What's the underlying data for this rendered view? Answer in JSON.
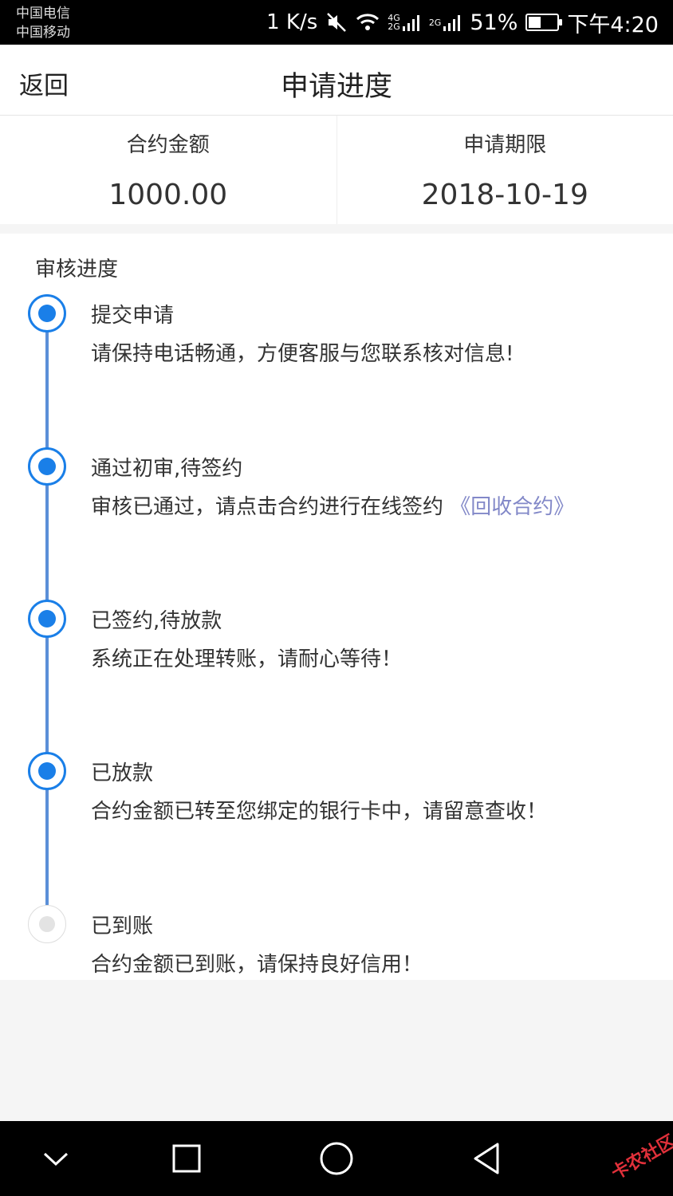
{
  "status_bar": {
    "carrier_1": "中国电信",
    "carrier_2": "中国移动",
    "net_speed": "1 K/s",
    "signal_1_tag_top": "4G",
    "signal_1_tag_bottom": "2G",
    "signal_2_tag": "2G",
    "battery_percent": "51%",
    "battery_level": 0.51,
    "time": "下午4:20",
    "icons": [
      "mute-icon",
      "wifi-icon",
      "signal-icon",
      "signal-icon",
      "battery-icon"
    ]
  },
  "header": {
    "back_label": "返回",
    "title": "申请进度"
  },
  "summary": {
    "amount_label": "合约金额",
    "amount_value": "1000.00",
    "term_label": "申请期限",
    "term_value": "2018-10-19"
  },
  "progress": {
    "title": "审核进度",
    "steps": [
      {
        "title": "提交申请",
        "desc": "请保持电话畅通，方便客服与您联系核对信息!",
        "state": "done"
      },
      {
        "title": "通过初审,待签约",
        "desc": "审核已通过，请点击合约进行在线签约 ",
        "link": "《回收合约》",
        "state": "done"
      },
      {
        "title": "已签约,待放款",
        "desc": "系统正在处理转账，请耐心等待！",
        "state": "done"
      },
      {
        "title": "已放款",
        "desc": "合约金额已转至您绑定的银行卡中，请留意查收！",
        "state": "done"
      },
      {
        "title": "已到账",
        "desc": "合约金额已到账，请保持良好信用！",
        "state": "pending"
      }
    ]
  },
  "colors": {
    "accent": "#1a7fe8",
    "line": "#5b8fd8",
    "link": "#8288c8",
    "inactive": "#e3e3e3"
  },
  "nav_keys": [
    "chevron-down-icon",
    "square-icon",
    "circle-icon",
    "back-triangle-icon"
  ],
  "watermark": "卡农社区"
}
